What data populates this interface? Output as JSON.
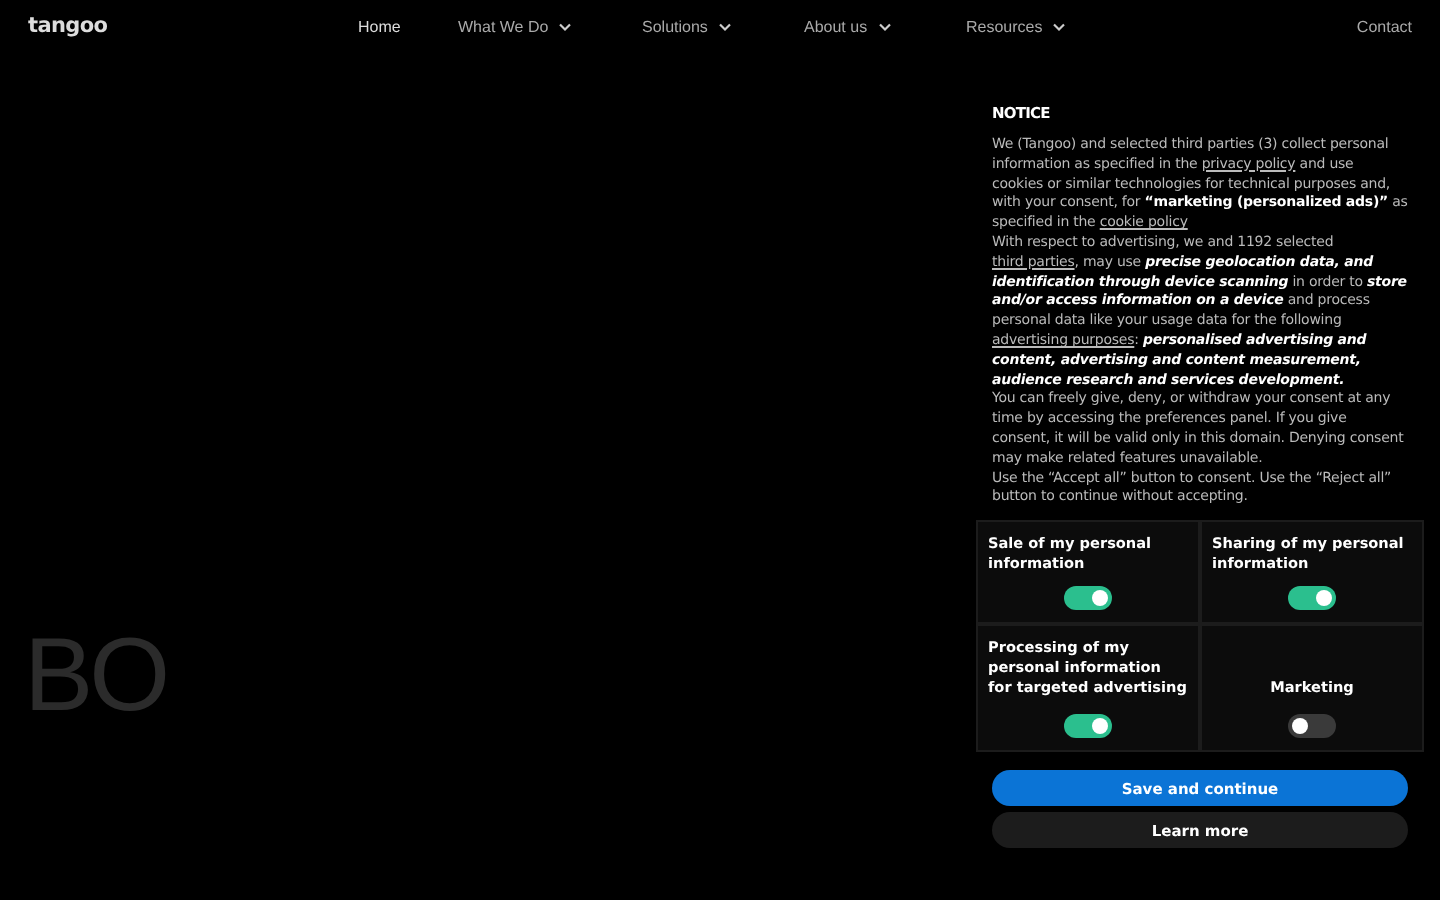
{
  "header": {
    "logo": "tangoo",
    "nav": [
      {
        "label": "Home",
        "selected": true,
        "dropdown": false
      },
      {
        "label": "What We Do",
        "selected": false,
        "dropdown": true
      },
      {
        "label": "Solutions",
        "selected": false,
        "dropdown": true
      },
      {
        "label": "About us",
        "selected": false,
        "dropdown": true
      },
      {
        "label": "Resources",
        "selected": false,
        "dropdown": true
      }
    ],
    "contact": "Contact"
  },
  "hero": {
    "text": "BO"
  },
  "notice": {
    "title": "NOTICE",
    "paragraphs": [
      [
        {
          "kind": "text",
          "text": "We (Tangoo) and selected third parties (3) collect personal information as specified in the "
        },
        {
          "kind": "link",
          "text": "privacy policy"
        },
        {
          "kind": "text",
          "text": " and use cookies or similar technologies for technical purposes and, with your consent, for **“marketing (personalized ads)”** as specified in the "
        },
        {
          "kind": "link",
          "text": "cookie policy"
        }
      ],
      [
        {
          "kind": "text",
          "text": "With respect to advertising, we and 1192 selected "
        },
        {
          "kind": "link",
          "text": "third parties"
        },
        {
          "kind": "text",
          "text": ", may use *precise geolocation data, and identification through device scanning* in order to *store and/or access information on a device* and process personal data like your usage data for the following "
        },
        {
          "kind": "link",
          "text": "advertising purposes"
        },
        {
          "kind": "text",
          "text": ": *personalised advertising and content, advertising and content measurement, audience research and services development.*"
        }
      ],
      [
        {
          "kind": "text",
          "text": "You can freely give, deny, or withdraw your consent at any time by accessing the preferences panel. If you give consent, it will be valid only in this domain. Denying consent may make related features unavailable."
        }
      ],
      [
        {
          "kind": "text",
          "text": "Use the “Accept all” button to consent. Use the “Reject all” button to continue without accepting."
        }
      ]
    ],
    "options": [
      {
        "label": "Sale of my personal information",
        "checked": true
      },
      {
        "label": "Sharing of my personal information",
        "checked": true
      },
      {
        "label": "Processing of my personal information for targeted advertising",
        "checked": true
      },
      {
        "label": "Marketing",
        "checked": false
      }
    ],
    "buttons": [
      {
        "label": "Save and continue",
        "kind": "primary"
      },
      {
        "label": "Learn more",
        "kind": "secondary"
      }
    ]
  }
}
